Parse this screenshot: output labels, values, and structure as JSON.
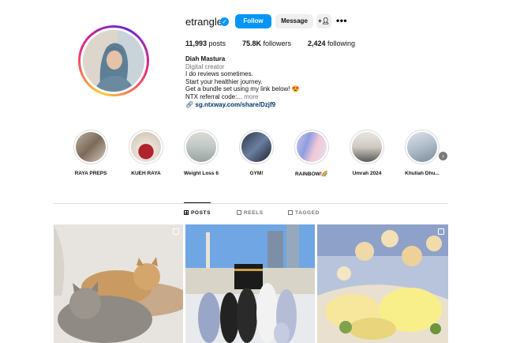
{
  "profile": {
    "username": "etrangle",
    "verified_icon": "verified-badge-icon",
    "follow_label": "Follow",
    "message_label": "Message",
    "suggest_label": "+R"
  },
  "stats": {
    "posts_count": "11,993",
    "posts_label": "posts",
    "followers_count": "75.8K",
    "followers_label": "followers",
    "following_count": "2,424",
    "following_label": "following"
  },
  "bio": {
    "name": "Diah Mastura",
    "category": "Digital creator",
    "line1": "I do reviews sometimes.",
    "line2": "Start your healthier journey.",
    "line3": "Get a bundle set using my link below! 😍",
    "line4": "NTX referral code:...",
    "more_label": "more",
    "link": "sg.ntxway.com/share/Dzjf9"
  },
  "highlights": [
    {
      "label": "RAYA PREPS"
    },
    {
      "label": "KUEH RAYA"
    },
    {
      "label": "Weight Loss 6"
    },
    {
      "label": "GYM!"
    },
    {
      "label": "RAINBOW!🌈"
    },
    {
      "label": "Umrah 2024"
    },
    {
      "label": "Khuliah Dhu..."
    }
  ],
  "tabs": {
    "posts": "POSTS",
    "reels": "REELS",
    "tagged": "TAGGED"
  },
  "colors": {
    "accent": "#0095f6",
    "link": "#00376b",
    "muted": "#737373"
  }
}
